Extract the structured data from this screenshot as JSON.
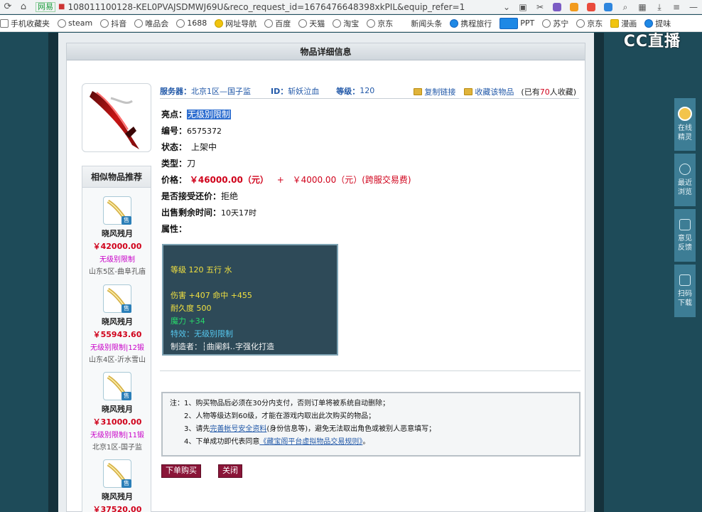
{
  "browser": {
    "secure_label": "网易",
    "url": "108011100128-KEL0PVAJSDMWJ69U&reco_request_id=1676476648398xkPIL&equip_refer=1",
    "bookmarks": [
      "手机收藏夹",
      "steam",
      "抖音",
      "唯品会",
      "1688",
      "网址导航",
      "百度",
      "天猫",
      "淘宝",
      "京东",
      "新闻头条",
      "携程旅行",
      "PPT",
      "苏宁",
      "京东",
      "漫画",
      "提味"
    ],
    "watermark": "CC直播"
  },
  "panel": {
    "title": "物品详细信息"
  },
  "info": {
    "server_label": "服务器：",
    "server_value": "北京1区—国子监",
    "id_label": "ID：",
    "id_value": "斩妖泣血",
    "level_label": "等级：",
    "level_value": "120",
    "copy_link": "复制链接",
    "fav_item": "收藏该物品",
    "fav_count_prefix": "(已有",
    "fav_count": "70",
    "fav_count_suffix": "人收藏)"
  },
  "fields": {
    "highlight_label": "亮点：",
    "highlight_value": "无级别限制",
    "serial_label": "编号：",
    "serial_value": "6575372",
    "status_label": "状态：",
    "status_value": "上架中",
    "type_label": "类型：",
    "type_value": "刀",
    "price_label": "价格：",
    "price_value": "￥46000.00（元）",
    "price_plus": "+",
    "fee_value": "￥4000.00（元）(跨服交易费)",
    "bargain_label": "是否接受还价：",
    "bargain_value": "拒绝",
    "remaining_label": "出售剩余时间：",
    "remaining_value": "10天17时",
    "attr_label": "属性："
  },
  "attributes": {
    "line1": "等级 120  五行 水",
    "line2": "伤害 +407 命中 +455",
    "line3": "耐久度 500",
    "line4": "魔力 +34",
    "line5": "特效：无级别限制",
    "line6": "制造者：┆曲阑斜‥字强化打造"
  },
  "similar": {
    "title": "相似物品推荐",
    "items": [
      {
        "name": "晓风残月",
        "price": "￥42000.00",
        "tag": "无级别限制",
        "server": "山东5区-曲阜孔庙",
        "badge": "售"
      },
      {
        "name": "晓风残月",
        "price": "￥55943.60",
        "tag": "无级别限制|12锻",
        "server": "山东4区-沂水雪山",
        "badge": "售"
      },
      {
        "name": "晓风残月",
        "price": "￥31000.00",
        "tag": "无级别限制|11锻",
        "server": "北京1区-国子监",
        "badge": "售"
      },
      {
        "name": "晓风残月",
        "price": "￥37520.00",
        "tag": "",
        "server": "",
        "badge": "售"
      }
    ]
  },
  "notes": {
    "l1": "注：1、购买物品后必须在30分内支付，否则订单将被系统自动删除；",
    "l2": "2、人物等级达到60级，才能在游戏内取出此次购买的物品；",
    "l3_a": "3、请先",
    "l3_link": "完善帐号安全资料",
    "l3_b": "(身份信息等)，避免无法取出角色或被别人恶意填写；",
    "l4_a": "4、下单成功即代表同意",
    "l4_link": "《藏宝阁平台虚拟物品交易规则》",
    "l4_b": "。"
  },
  "buttons": {
    "buy": "下单购买",
    "close": "关闭"
  },
  "floatbar": {
    "online": "在线精灵",
    "recent": "最近浏览",
    "feedback": "意见反馈",
    "scan": "扫码下载"
  }
}
